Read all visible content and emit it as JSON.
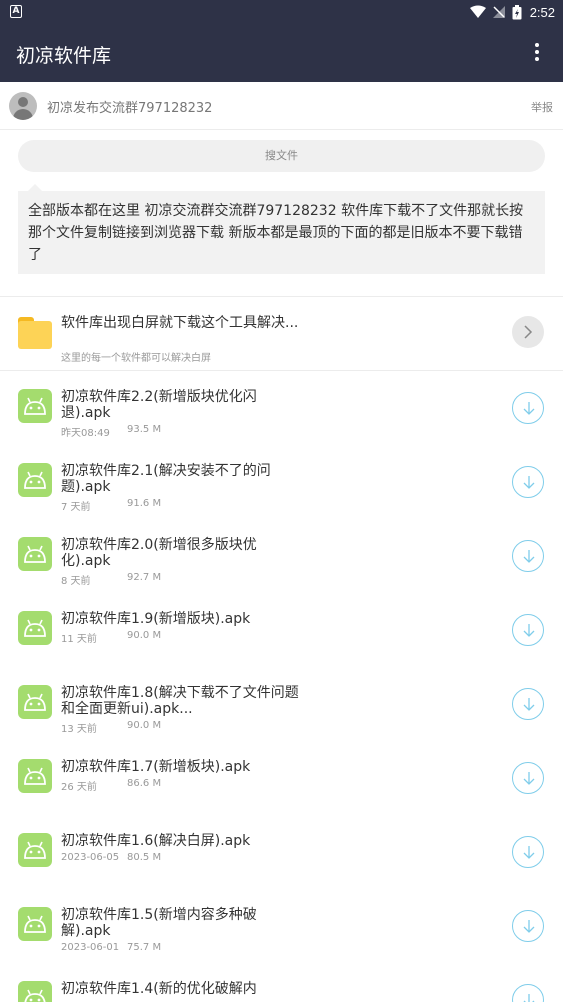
{
  "status_bar": {
    "time": "2:52",
    "icons": [
      "notification-a-icon",
      "wifi-icon",
      "no-signal-icon",
      "battery-charging-icon"
    ]
  },
  "app_bar": {
    "title": "初凉软件库",
    "menu_icon": "more-vertical-icon"
  },
  "post": {
    "poster": "初凉发布交流群797128232",
    "report": "举报"
  },
  "search": {
    "placeholder": "搜文件"
  },
  "notice": {
    "text": "全部版本都在这里 初凉交流群交流群797128232 软件库下载不了文件那就长按那个文件复制链接到浏览器下载 新版本都是最顶的下面的都是旧版本不要下载错了"
  },
  "folder": {
    "title": "软件库出现白屏就下载这个工具解决...",
    "subtitle": "这里的每一个软件都可以解决白屏"
  },
  "files": [
    {
      "name": "初凉软件库2.2(新增版块优化闪退).apk",
      "date": "昨天08:49",
      "size": "93.5 M"
    },
    {
      "name": "初凉软件库2.1(解决安装不了的问题).apk",
      "date": "7 天前",
      "size": "91.6 M"
    },
    {
      "name": "初凉软件库2.0(新增很多版块优化).apk",
      "date": "8 天前",
      "size": "92.7 M"
    },
    {
      "name": "初凉软件库1.9(新增版块).apk",
      "date": "11 天前",
      "size": "90.0 M"
    },
    {
      "name": "初凉软件库1.8(解决下载不了文件问题和全面更新ui).apk...",
      "date": "13 天前",
      "size": "90.0 M"
    },
    {
      "name": "初凉软件库1.7(新增板块).apk",
      "date": "26 天前",
      "size": "86.6 M"
    },
    {
      "name": "初凉软件库1.6(解决白屏).apk",
      "date": "2023-06-05",
      "size": "80.5 M"
    },
    {
      "name": "初凉软件库1.5(新增内容多种破解).apk",
      "date": "2023-06-01",
      "size": "75.7 M"
    },
    {
      "name": "初凉软件库1.4(新的优化破解内",
      "date": "",
      "size": ""
    }
  ],
  "colors": {
    "app_bar": "#2e3247",
    "apk_icon": "#a4dc6e",
    "download_ring": "#7fcdea",
    "folder": "#fdd356"
  }
}
